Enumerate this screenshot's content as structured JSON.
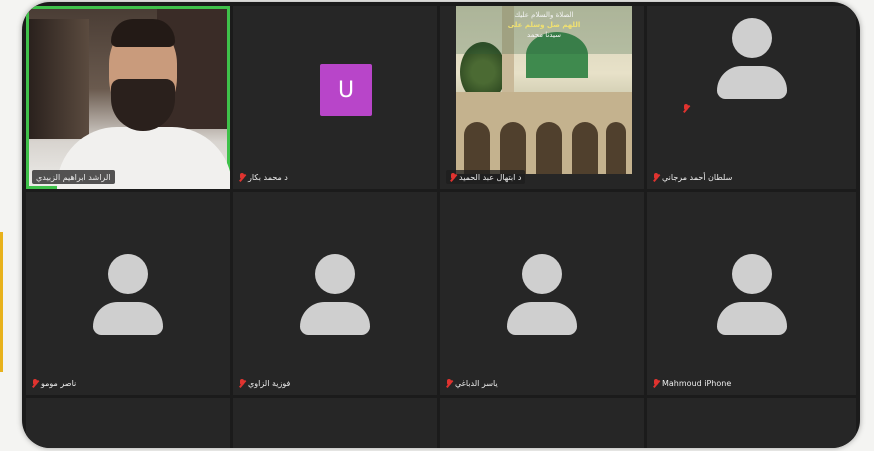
{
  "meeting": {
    "participants": [
      {
        "name": "الراشد ابراهيم الزبيدي",
        "mic_muted": false,
        "has_video": true
      },
      {
        "name": "د محمد بكار",
        "mic_muted": true,
        "avatar_letter": "U",
        "avatar_color": "#b845c9"
      },
      {
        "name": "د ابتهال عبد الحميد",
        "mic_muted": true,
        "shared_image": {
          "line1": "الصلاة والسلام عليك",
          "line2": "اللهم صل وسلم على",
          "line3": "سيدنا محمد"
        }
      },
      {
        "name": "سلطان أحمد مرجاني",
        "mic_muted": true
      },
      {
        "name": "ناصر مومو",
        "mic_muted": true
      },
      {
        "name": "فوزية الزاوي",
        "mic_muted": true
      },
      {
        "name": "ياسر الدباغي",
        "mic_muted": true
      },
      {
        "name": "Mahmoud iPhone",
        "mic_muted": true
      }
    ]
  },
  "colors": {
    "tile_bg": "#262626",
    "active_speaker_border": "#3fc14a",
    "muted_mic": "#e0332f",
    "accent": "#e8b21c"
  }
}
